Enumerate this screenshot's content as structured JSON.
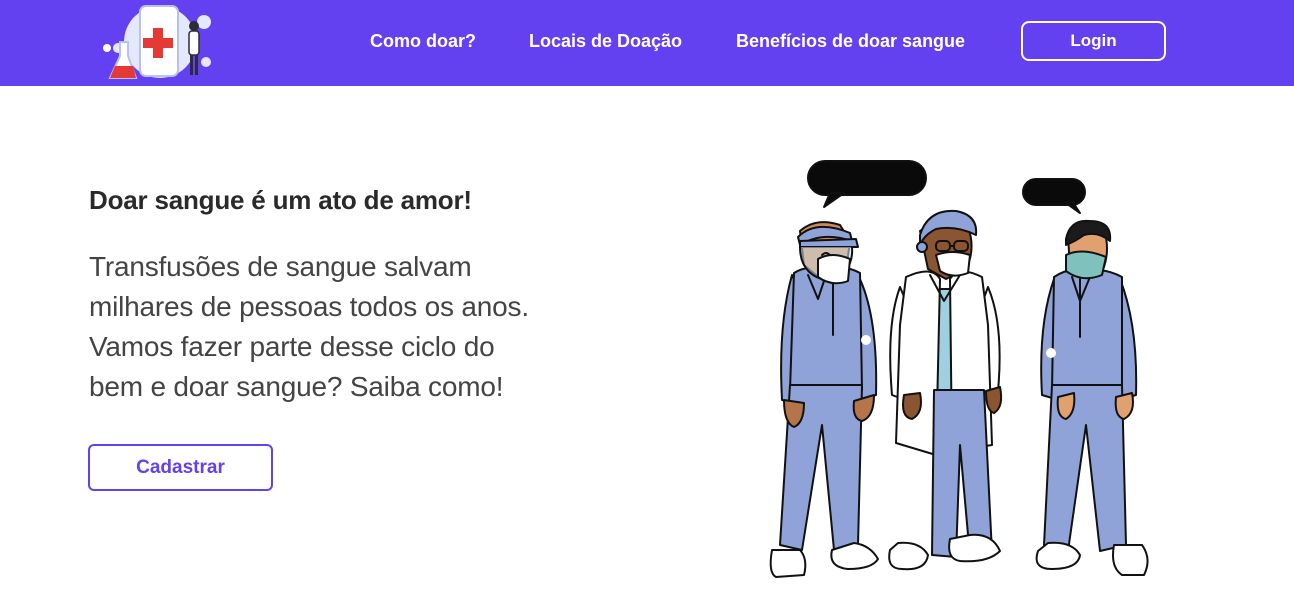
{
  "nav": {
    "logo_icon": "medical-phone-logo",
    "links": [
      "Como doar?",
      "Locais de Doação",
      "Benefícios de doar sangue"
    ],
    "login_label": "Login"
  },
  "hero": {
    "title": "Doar sangue é um ato de amor!",
    "text_lines": [
      "Transfusões de sangue salvam",
      "milhares de pessoas todos os anos.",
      "Vamos fazer parte desse ciclo do",
      "bem e doar sangue? Saiba como!"
    ],
    "cta_label": "Cadastrar"
  },
  "illustration": {
    "icon": "three-health-workers-illustration"
  },
  "colors": {
    "brand": "#6441F0",
    "scrub": "#8FA3D8",
    "text_dark": "#2a2a2a",
    "text_body": "#444444"
  }
}
